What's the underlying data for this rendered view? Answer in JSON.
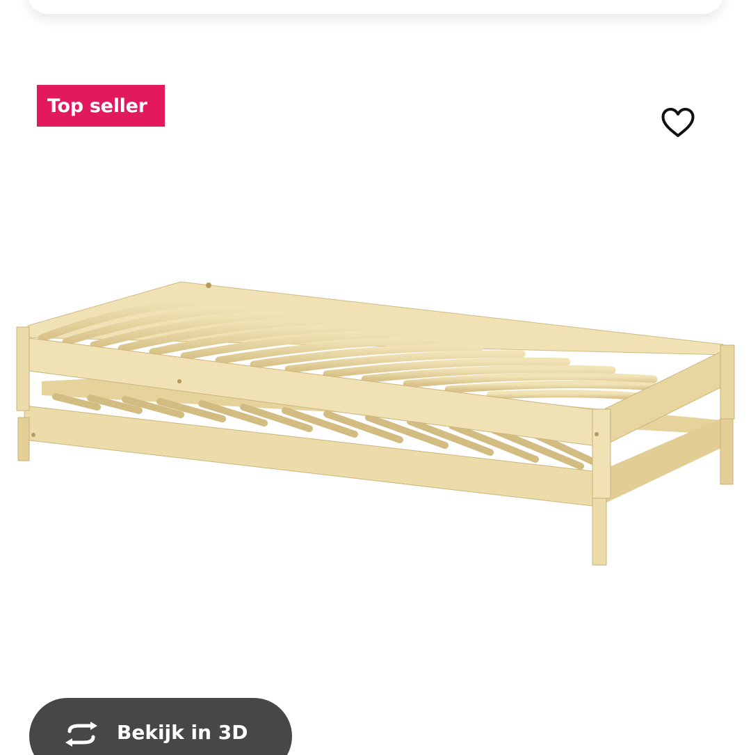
{
  "badge": {
    "label": "Top seller",
    "color": "#e2195c"
  },
  "favorite": {
    "icon": "heart-outline-icon"
  },
  "product_image": {
    "description_icon": "stackable-bed-image",
    "wood_color": "#ecdcaa",
    "wood_shadow": "#d8c28a"
  },
  "view3d": {
    "icon": "rotate-3d-icon",
    "label": "Bekijk in 3D",
    "background": "#474747"
  }
}
